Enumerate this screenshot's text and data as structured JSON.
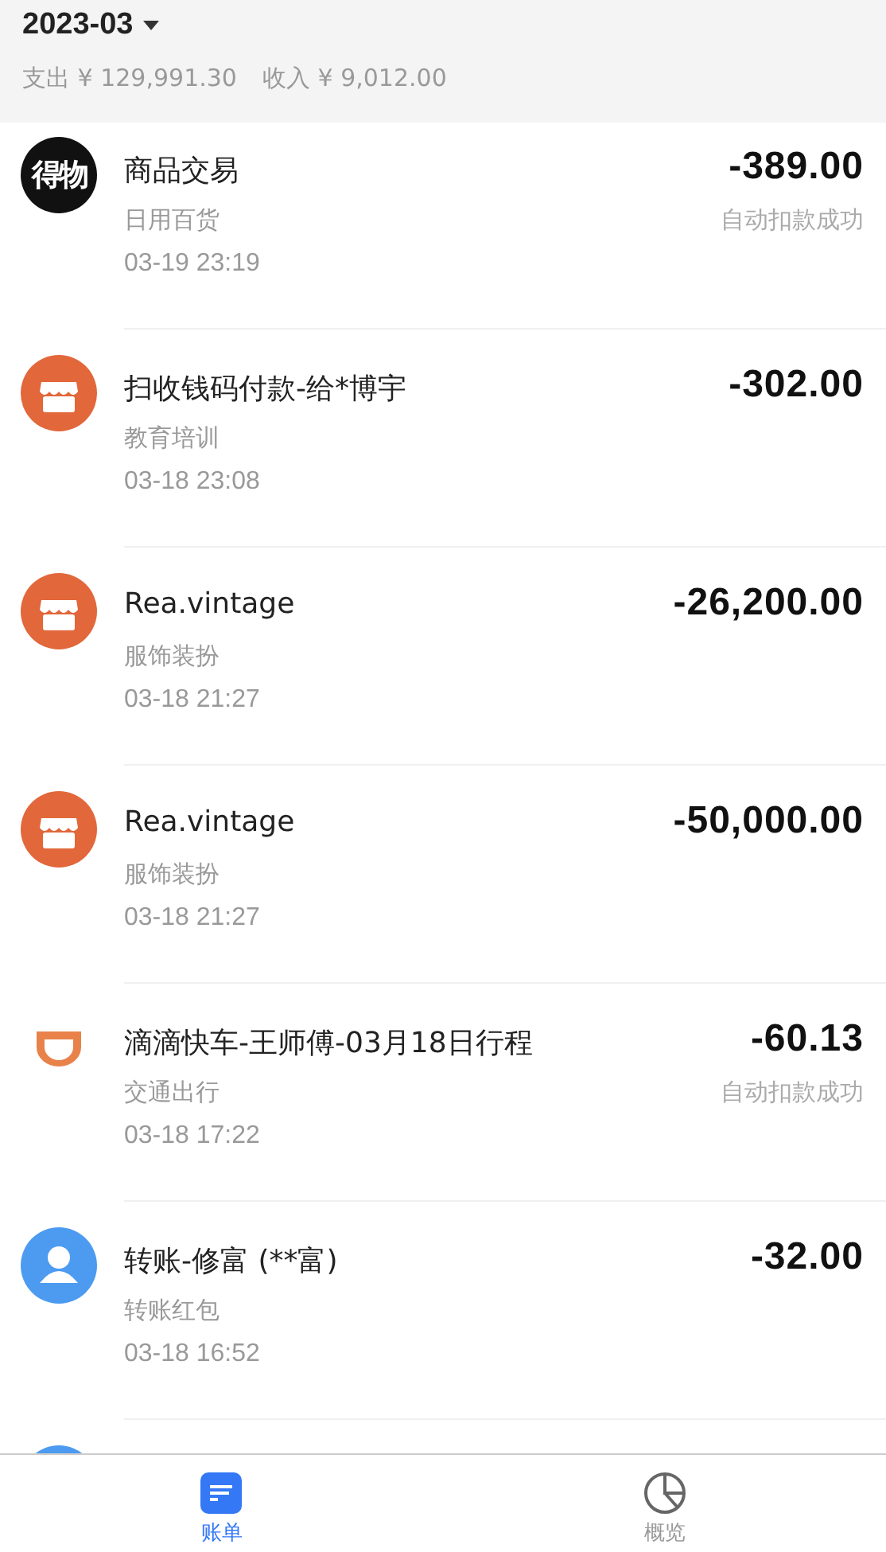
{
  "header": {
    "month": "2023-03",
    "expense_label": "支出",
    "expense": "¥ 129,991.30",
    "income_label": "收入",
    "income": "¥ 9,012.00"
  },
  "transactions": [
    {
      "kind": "logo",
      "logo_text": "得物",
      "title": "商品交易",
      "category": "日用百货",
      "date": "03-19  23:19",
      "amount": "-389.00",
      "status": "自动扣款成功"
    },
    {
      "kind": "shop",
      "title": "扫收钱码付款-给*博宇",
      "category": "教育培训",
      "date": "03-18  23:08",
      "amount": "-302.00"
    },
    {
      "kind": "shop",
      "title": "Rea.vintage",
      "category": "服饰装扮",
      "date": "03-18  21:27",
      "amount": "-26,200.00"
    },
    {
      "kind": "shop",
      "title": "Rea.vintage",
      "category": "服饰装扮",
      "date": "03-18  21:27",
      "amount": "-50,000.00"
    },
    {
      "kind": "ride",
      "title": "滴滴快车-王师傅-03月18日行程",
      "category": "交通出行",
      "date": "03-18  17:22",
      "amount": "-60.13",
      "status": "自动扣款成功"
    },
    {
      "kind": "person",
      "title": "转账-修富 (**富)",
      "category": "转账红包",
      "date": "03-18  16:52",
      "amount": "-32.00"
    },
    {
      "kind": "person"
    }
  ],
  "tabs": [
    {
      "label": "账单",
      "kind": "bill",
      "selected": true
    },
    {
      "label": "概览",
      "kind": "pie",
      "selected": false
    }
  ]
}
